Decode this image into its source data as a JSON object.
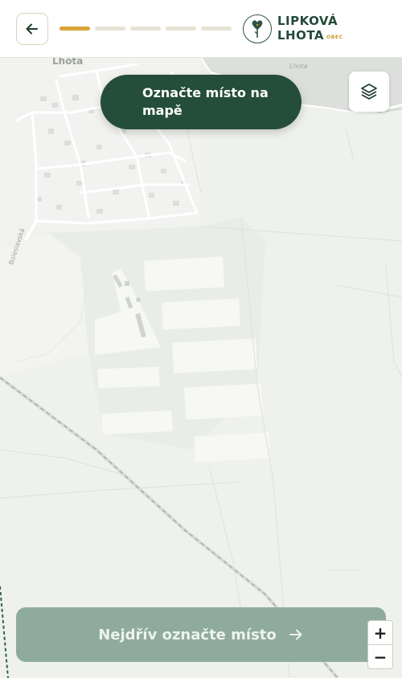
{
  "header": {
    "back_label": "Zpět",
    "progress_total": 5,
    "progress_current": 1,
    "logo": {
      "line1": "LIPKOVÁ",
      "line2": "LHOTA",
      "sub": "OBEC"
    }
  },
  "map": {
    "labels": {
      "village": "Lhota",
      "lake": "Lhota",
      "road": "Boleslavská"
    }
  },
  "instruction": {
    "text": "Označte místo na mapě"
  },
  "cta": {
    "label": "Nejdřív označte místo",
    "arrow": "→"
  },
  "zoom": {
    "in": "+",
    "out": "−"
  },
  "icons": {
    "back": "arrow-left-icon",
    "layers": "layers-icon",
    "cta": "arrow-right-icon",
    "logo": "heart-tree-icon"
  },
  "colors": {
    "primary": "#244d3a",
    "accent": "#d8a536",
    "disabled": "#8fab9d",
    "map_bg": "#eef1ec"
  }
}
